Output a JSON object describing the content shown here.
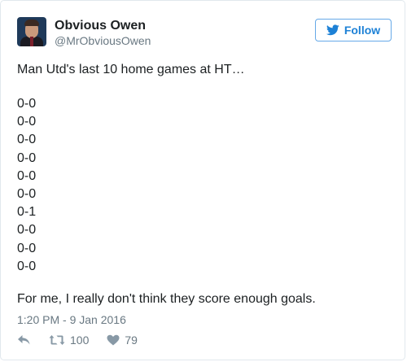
{
  "author": {
    "name": "Obvious Owen",
    "handle": "@MrObviousOwen",
    "avatar_icon": "profile-photo"
  },
  "follow_button": {
    "label": "Follow",
    "icon": "twitter-bird-icon",
    "color": "#1d81d6"
  },
  "tweet": {
    "intro": "Man Utd's last 10 home games at HT…",
    "scores": [
      "0-0",
      "0-0",
      "0-0",
      "0-0",
      "0-0",
      "0-0",
      "0-1",
      "0-0",
      "0-0",
      "0-0"
    ],
    "closing": "For me, I really don't think they score enough goals.",
    "timestamp": "1:20 PM - 9 Jan 2016"
  },
  "actions": {
    "reply_icon": "reply-icon",
    "retweet_icon": "retweet-icon",
    "retweet_count": "100",
    "like_icon": "heart-icon",
    "like_count": "79"
  }
}
